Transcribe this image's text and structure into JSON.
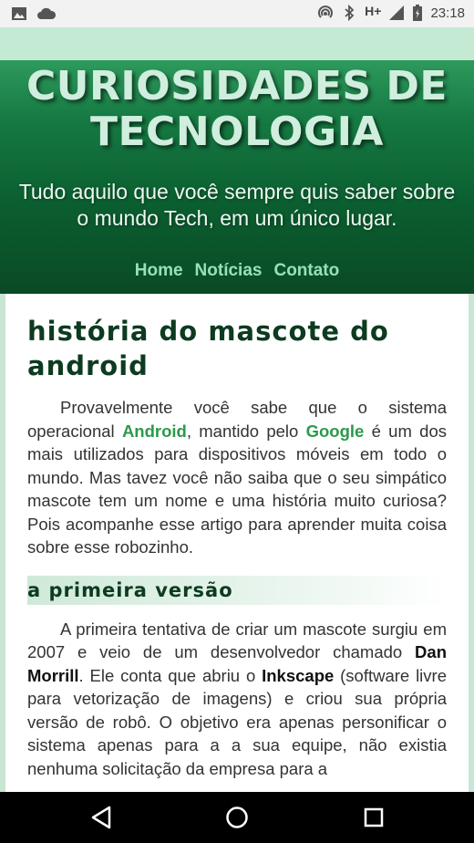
{
  "status": {
    "time": "23:18",
    "network": "H+",
    "left_icons": [
      "image-icon",
      "cloud-icon"
    ],
    "right_icons": [
      "hotspot-icon",
      "bluetooth-icon",
      "signal-icon",
      "battery-icon"
    ]
  },
  "header": {
    "title": "CURIOSIDADES DE TECNOLOGIA",
    "tagline": "Tudo aquilo que você sempre quis saber sobre o mundo Tech, em um único lugar.",
    "nav": [
      "Home",
      "Notícias",
      "Contato"
    ]
  },
  "article": {
    "title": "História do Mascote do Android",
    "p1": {
      "a": "Provavelmente você sabe que o sistema operacional ",
      "android": "Android",
      "b": ", mantido pelo ",
      "google": "Google",
      "c": " é um dos mais utilizados para dispositivos móveis em todo o mundo. Mas tavez você não saiba que o seu simpático mascote tem um nome e uma história muito curiosa? Pois acompanhe esse artigo para aprender muita coisa sobre esse robozinho."
    },
    "section1": {
      "heading": "A Primeira Versão",
      "p": {
        "a": "A primeira tentativa de criar um mascote surgiu em 2007 e veio de um desenvolvedor chamado ",
        "dan": "Dan Morrill",
        "b": ". Ele conta que abriu o ",
        "inkscape": "Inkscape",
        "c": " (software livre para vetorização de imagens) e criou sua própria versão de robô. O objetivo era apenas personificar o sistema apenas para a a sua equipe, não existia nenhuma solicitação da empresa para a"
      }
    }
  },
  "colors": {
    "header_top": "#2e9a5c",
    "header_bottom": "#0a4a25",
    "nav_link": "#98e0b6",
    "highlight": "#2b9a4a",
    "heading": "#0d3b20"
  },
  "system_nav": [
    "back-icon",
    "home-icon",
    "recents-icon"
  ]
}
